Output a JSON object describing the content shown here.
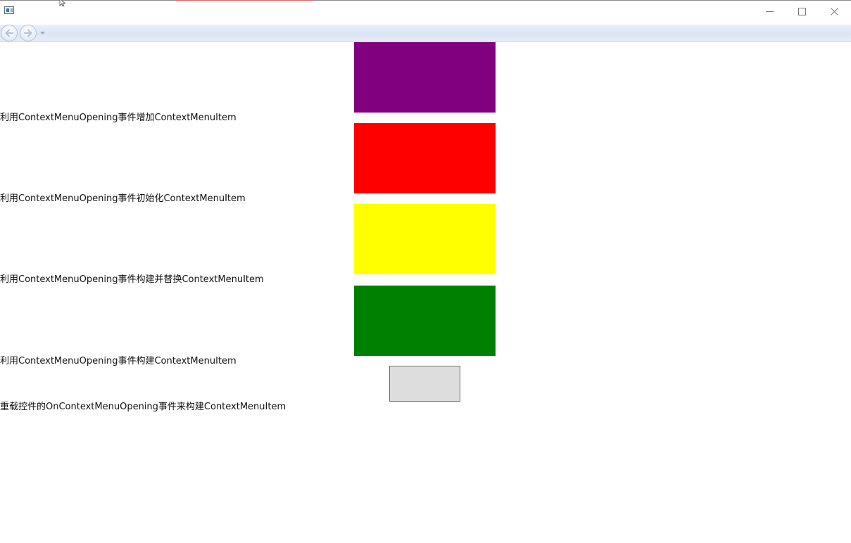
{
  "window": {
    "title": "",
    "icons": {
      "app": "app-window-icon",
      "minimize": "minimize-icon",
      "maximize": "maximize-icon",
      "close": "close-icon"
    }
  },
  "navigation": {
    "back_icon": "arrow-left-icon",
    "forward_icon": "arrow-right-icon",
    "history_icon": "chevron-down-icon"
  },
  "content": {
    "rows": [
      {
        "label": "利用ContextMenuOpening事件增加ContextMenuItem",
        "color": "#800080"
      },
      {
        "label": "利用ContextMenuOpening事件初始化ContextMenuItem",
        "color": "#ff0000"
      },
      {
        "label": "利用ContextMenuOpening事件构建并替换ContextMenuItem",
        "color": "#ffff00"
      },
      {
        "label": "利用ContextMenuOpening事件构建ContextMenuItem",
        "color": "#008000"
      }
    ],
    "override_row": {
      "label": "重载控件的OnContextMenuOpening事件来构建ContextMenuItem",
      "button_color": "#dddddd"
    }
  }
}
